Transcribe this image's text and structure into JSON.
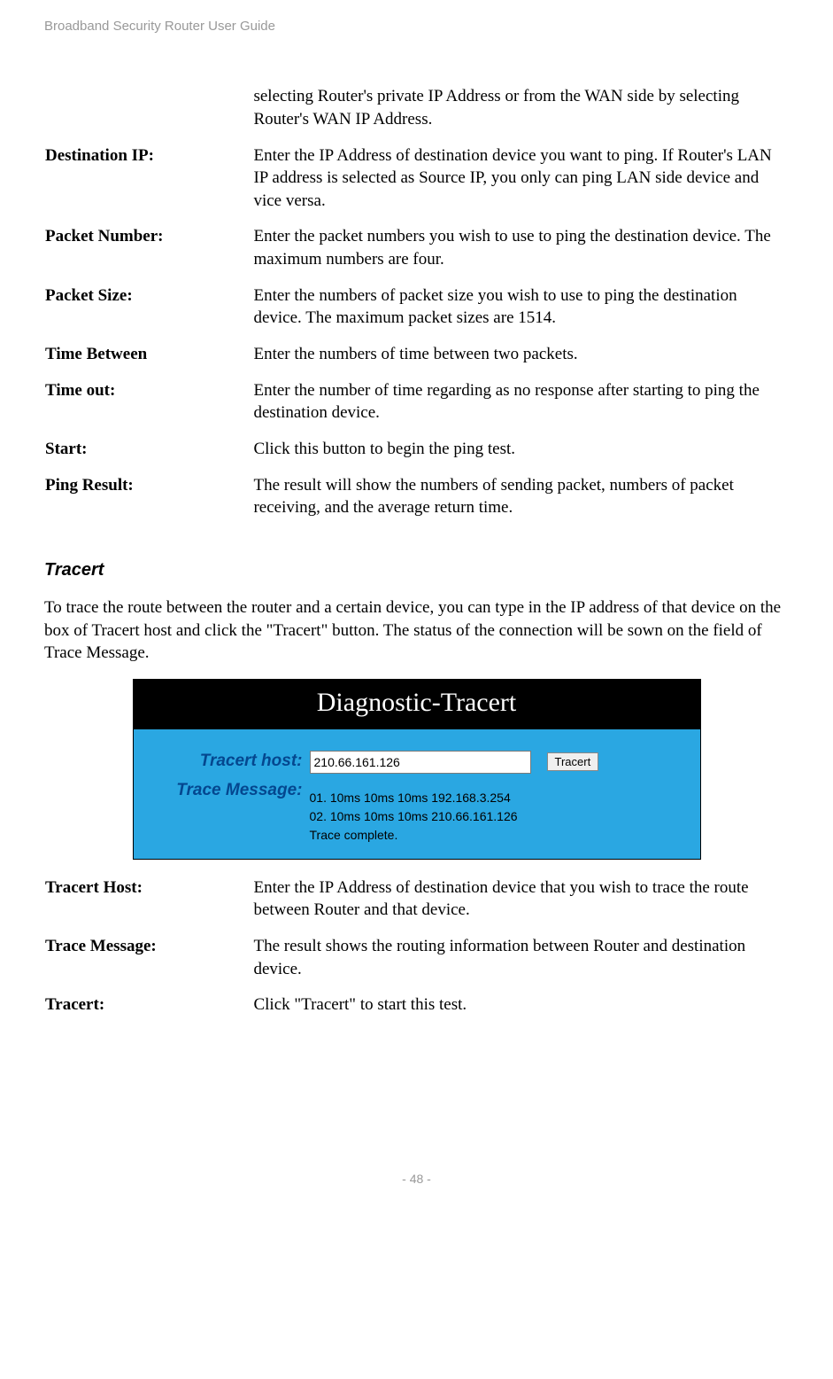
{
  "header": "Broadband Security Router User Guide",
  "intro_continuation": "selecting Router's private IP Address or from the WAN side by selecting Router's WAN IP Address.",
  "defs1": [
    {
      "label": "Destination IP:",
      "value": "Enter the IP Address of destination device you want to ping. If Router's LAN IP address is selected as Source IP, you only can ping LAN side device and vice versa."
    },
    {
      "label": "Packet Number:",
      "value": "Enter the packet numbers you wish to use to ping the destination device. The maximum numbers are four."
    },
    {
      "label": "Packet Size:",
      "value": "Enter the numbers of packet size you wish to use to ping the destination device. The maximum packet sizes are 1514."
    },
    {
      "label": "Time Between",
      "value": "Enter the numbers of time between two packets."
    },
    {
      "label": "Time out:",
      "value": "Enter the number of time regarding as no response after starting to ping the destination device."
    },
    {
      "label": "Start:",
      "value": "Click this button to begin the ping test."
    },
    {
      "label": "Ping Result:",
      "value": "The result will show the numbers of sending packet, numbers of packet receiving, and the average return time."
    }
  ],
  "tracert": {
    "heading": "Tracert",
    "intro": "To trace the route between the router and a certain device, you can type in the IP address of that device on the box of Tracert host and click the \"Tracert\" button. The status of the connection will be sown on the field of Trace Message.",
    "widget": {
      "title": "Diagnostic-Tracert",
      "host_label": "Tracert host:",
      "msg_label": "Trace Message:",
      "host_value": "210.66.161.126",
      "button": "Tracert",
      "lines": [
        "01. 10ms 10ms 10ms 192.168.3.254",
        "02. 10ms 10ms 10ms 210.66.161.126",
        "Trace complete."
      ]
    }
  },
  "defs2": [
    {
      "label": "Tracert Host:",
      "value": "Enter the IP Address of destination device that you wish to trace the route between Router and that device."
    },
    {
      "label": "Trace Message:",
      "value": "The result shows the routing information between Router and destination device."
    },
    {
      "label": "Tracert:",
      "value": "Click \"Tracert\" to start this test."
    }
  ],
  "footer": "- 48 -"
}
